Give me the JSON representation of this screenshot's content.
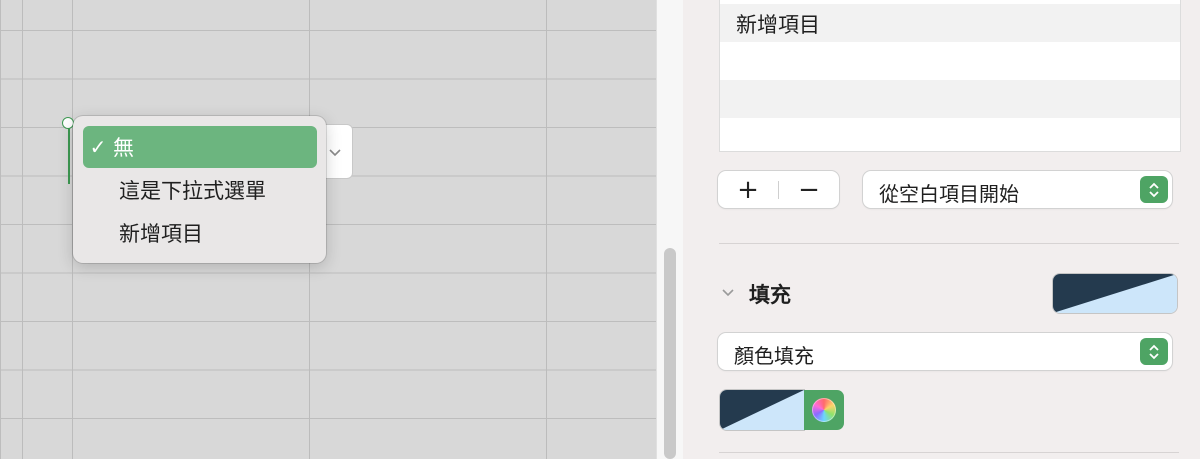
{
  "popup_menu": {
    "items": [
      {
        "label": "無",
        "checked": true,
        "check_glyph": "✓"
      },
      {
        "label": "這是下拉式選單",
        "checked": false,
        "check_glyph": ""
      },
      {
        "label": "新增項目",
        "checked": false,
        "check_glyph": ""
      }
    ]
  },
  "list_options": {
    "items": [
      "新增項目",
      "",
      "",
      ""
    ]
  },
  "list_controls": {
    "add_label": "+",
    "remove_label": "−"
  },
  "initial_value_select": {
    "value": "從空白項目開始"
  },
  "fill_section": {
    "title": "填充",
    "fill_type_select": {
      "value": "顏色填充"
    }
  },
  "colors": {
    "accent": "#4ea464",
    "menu_selected": "#6cb57f",
    "swatch_dark": "#243a4e",
    "swatch_light": "#cde6fa"
  },
  "icons": {
    "disclosure": "chevron-down-icon",
    "popup_arrow": "chevron-down-icon",
    "stepper": "up-down-arrows-icon",
    "color_picker": "color-wheel-icon"
  }
}
